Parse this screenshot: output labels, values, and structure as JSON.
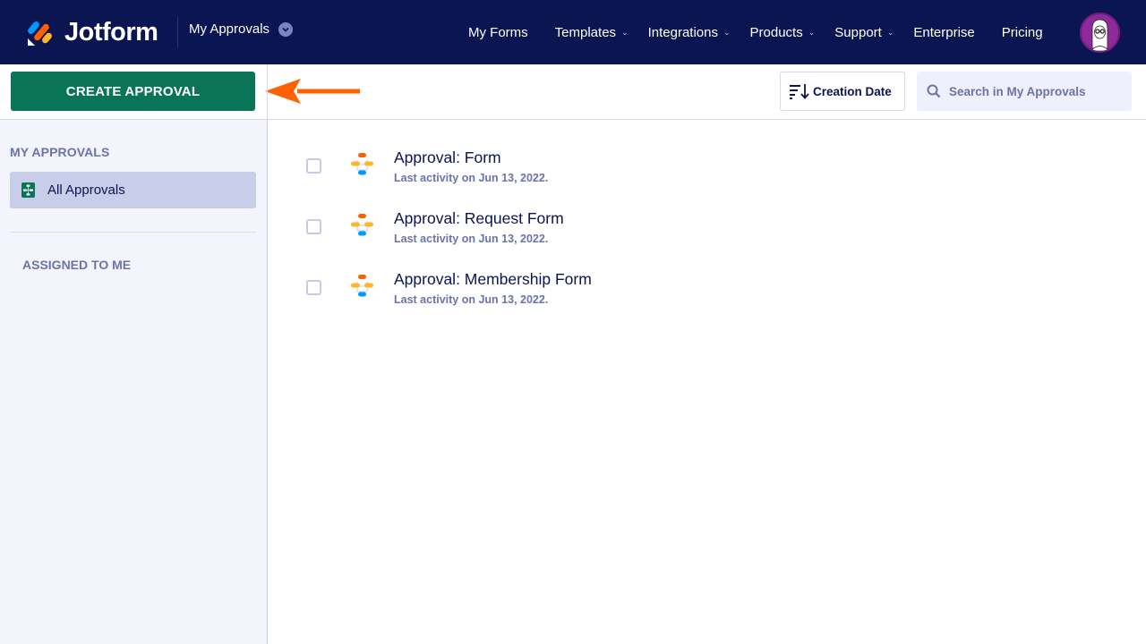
{
  "nav": {
    "brand": "Jotform",
    "app_switch": "My Approvals",
    "links": [
      {
        "label": "My Forms",
        "has_dropdown": false
      },
      {
        "label": "Templates",
        "has_dropdown": true
      },
      {
        "label": "Integrations",
        "has_dropdown": true
      },
      {
        "label": "Products",
        "has_dropdown": true
      },
      {
        "label": "Support",
        "has_dropdown": true
      },
      {
        "label": "Enterprise",
        "has_dropdown": false
      },
      {
        "label": "Pricing",
        "has_dropdown": false
      }
    ],
    "avatar_icon": "user-avatar-icon"
  },
  "toolbar": {
    "create_label": "CREATE APPROVAL",
    "sort_label": "Creation Date",
    "search_placeholder": "Search in My Approvals",
    "search_value": ""
  },
  "sidebar": {
    "heading": "MY APPROVALS",
    "items": [
      {
        "label": "All Approvals",
        "icon": "approval-flow-icon",
        "active": true
      }
    ],
    "assigned_label": "ASSIGNED TO ME"
  },
  "approvals": [
    {
      "title": "Approval: Form",
      "subtitle": "Last activity on Jun 13, 2022."
    },
    {
      "title": "Approval: Request Form",
      "subtitle": "Last activity on Jun 13, 2022."
    },
    {
      "title": "Approval: Membership Form",
      "subtitle": "Last activity on Jun 13, 2022."
    }
  ],
  "colors": {
    "nav_bg": "#0a1551",
    "primary_green": "#0a7458",
    "annotation_arrow": "#ff6100",
    "sidebar_bg": "#f3f4fc",
    "active_item_bg": "#c8cde9"
  }
}
